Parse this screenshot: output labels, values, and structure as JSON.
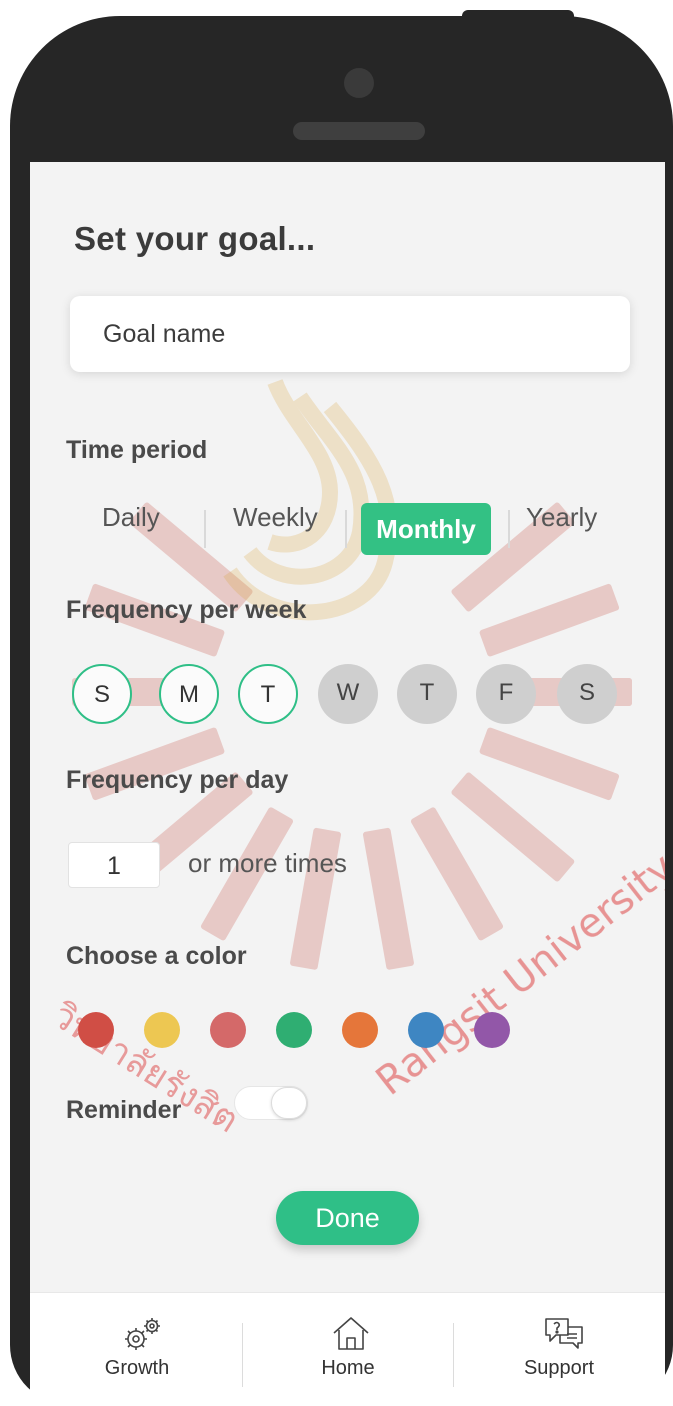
{
  "title": "Set your goal...",
  "goal_name": {
    "placeholder": "Goal name",
    "value": ""
  },
  "time_period": {
    "label": "Time period",
    "options": [
      "Daily",
      "Weekly",
      "Monthly",
      "Yearly"
    ],
    "selected": "Monthly"
  },
  "frequency_week": {
    "label": "Frequency per week",
    "days": [
      {
        "letter": "S",
        "selected": true
      },
      {
        "letter": "M",
        "selected": true
      },
      {
        "letter": "T",
        "selected": true
      },
      {
        "letter": "W",
        "selected": false
      },
      {
        "letter": "T",
        "selected": false
      },
      {
        "letter": "F",
        "selected": false
      },
      {
        "letter": "S",
        "selected": false
      }
    ]
  },
  "frequency_day": {
    "label": "Frequency per day",
    "value": "1",
    "suffix": "or more times"
  },
  "color": {
    "label": "Choose a color",
    "swatches": [
      "#d04e45",
      "#edc752",
      "#d46969",
      "#2fae72",
      "#e5763a",
      "#3e86c2",
      "#9257a8"
    ]
  },
  "reminder": {
    "label": "Reminder",
    "enabled": false
  },
  "done_label": "Done",
  "tabs": [
    {
      "icon": "gears-icon",
      "label": "Growth"
    },
    {
      "icon": "home-icon",
      "label": "Home"
    },
    {
      "icon": "chat-support-icon",
      "label": "Support"
    }
  ],
  "watermark": {
    "university_thai": "วิทยาลัยรังสิต",
    "university_en": "Rangsit University"
  },
  "colors": {
    "accent": "#2fbf87",
    "device": "#262626",
    "screen": "#f3f3f3"
  }
}
